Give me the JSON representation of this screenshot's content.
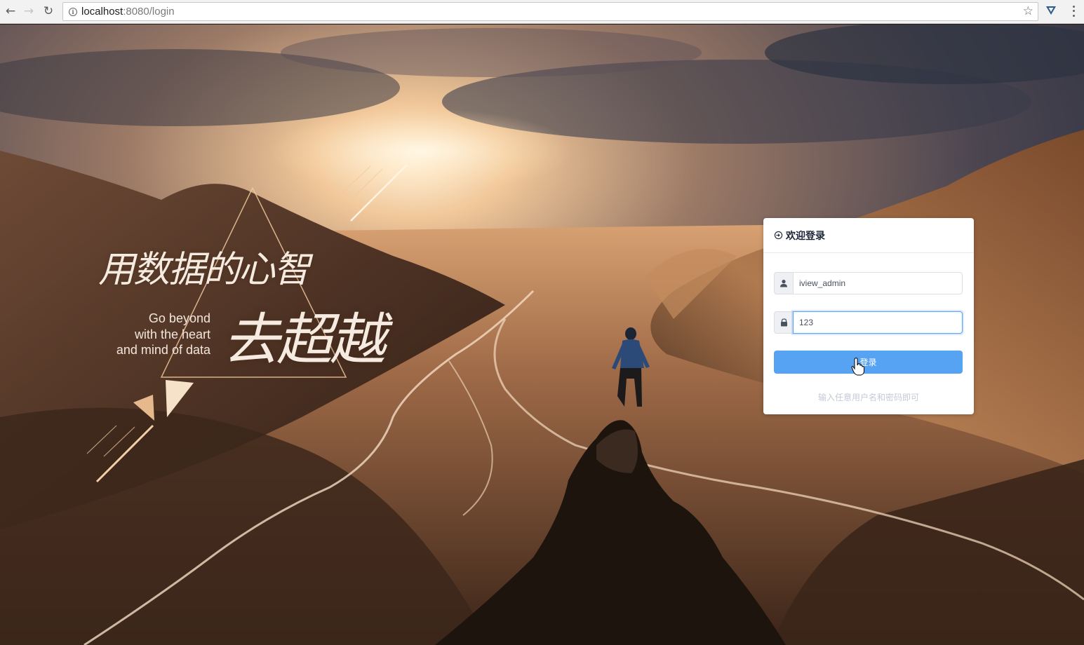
{
  "browser": {
    "url_host": "localhost",
    "url_rest": ":8080/login",
    "icons": [
      "back-icon",
      "forward-icon",
      "reload-icon",
      "info-icon",
      "star-icon",
      "extension-icon",
      "menu-icon"
    ]
  },
  "slogan": {
    "zh_line1": "用数据的心智",
    "zh_line2": "去超越",
    "en_line1": "Go beyond",
    "en_line2": "with the heart",
    "en_line3": "and mind of data"
  },
  "login_card": {
    "title": "欢迎登录",
    "username_value": "iview_admin",
    "password_value": "123",
    "submit_label": "登录",
    "hint": "输入任意用户名和密码即可",
    "colors": {
      "primary": "#57a3f3",
      "hint": "#c3cbd6",
      "title": "#1c2438"
    }
  }
}
